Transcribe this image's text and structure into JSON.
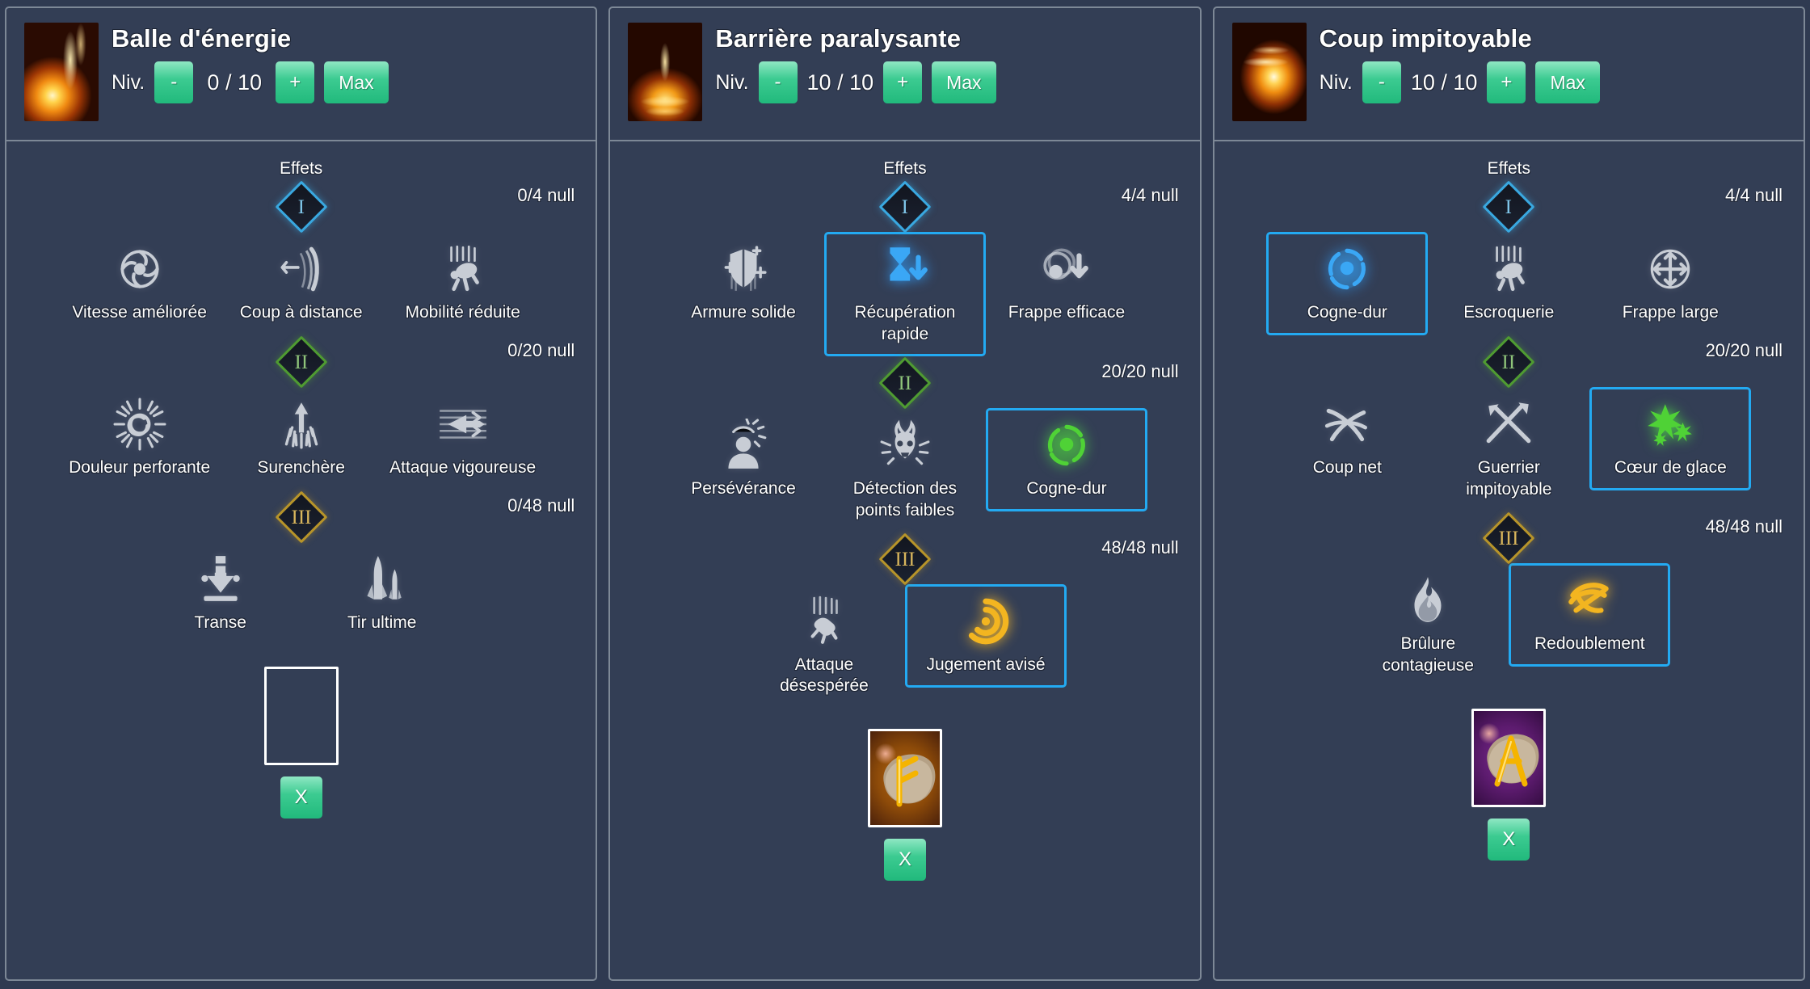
{
  "colors": {
    "page_bg": "#2f3a51",
    "panel_bg": "#333e55",
    "panel_border": "#7d8896",
    "accent_button": "#21b97c",
    "selection_border": "#23aaf2",
    "tier1": "#39a8e0",
    "tier2": "#4f9b31",
    "tier3": "#b79429",
    "text": "#ffffff"
  },
  "common": {
    "level_label": "Niv.",
    "minus_label": "-",
    "plus_label": "+",
    "max_label": "Max",
    "effects_label": "Effets",
    "clear_rune_label": "X"
  },
  "panels": [
    {
      "title": "Balle d'énergie",
      "icon": "comet-icon",
      "level_value": "0 / 10",
      "tiers": [
        {
          "roman": "I",
          "counter": "0/4 null",
          "perks": [
            {
              "name": "Vitesse améliorée",
              "icon": "speed-orb-icon",
              "selected": false,
              "state": "dim"
            },
            {
              "name": "Coup à distance",
              "icon": "ranged-strike-icon",
              "selected": false,
              "state": "dim"
            },
            {
              "name": "Mobilité réduite",
              "icon": "reduced-mobility-icon",
              "selected": false,
              "state": "dim"
            }
          ]
        },
        {
          "roman": "II",
          "counter": "0/20 null",
          "perks": [
            {
              "name": "Douleur perforante",
              "icon": "piercing-pain-icon",
              "selected": false,
              "state": "dim"
            },
            {
              "name": "Surenchère",
              "icon": "overbid-burst-icon",
              "selected": false,
              "state": "dim"
            },
            {
              "name": "Attaque vigoureuse",
              "icon": "vigorous-attack-icon",
              "selected": false,
              "state": "dim"
            }
          ]
        },
        {
          "roman": "III",
          "counter": "0/48 null",
          "perks": [
            {
              "name": "Transe",
              "icon": "trance-arrow-icon",
              "selected": false,
              "state": "dim"
            },
            {
              "name": "Tir ultime",
              "icon": "ultimate-shot-icon",
              "selected": false,
              "state": "dim"
            }
          ]
        }
      ],
      "rune": {
        "present": false,
        "glyph": "",
        "bg": "none"
      }
    },
    {
      "title": "Barrière paralysante",
      "icon": "barrier-icon",
      "level_value": "10 / 10",
      "tiers": [
        {
          "roman": "I",
          "counter": "4/4 null",
          "perks": [
            {
              "name": "Armure solide",
              "icon": "solid-armor-icon",
              "selected": false,
              "state": "dim"
            },
            {
              "name": "Récupération rapide",
              "icon": "fast-recovery-icon",
              "selected": true,
              "state": "lit-blue"
            },
            {
              "name": "Frappe efficace",
              "icon": "efficient-strike-icon",
              "selected": false,
              "state": "dim"
            }
          ]
        },
        {
          "roman": "II",
          "counter": "20/20 null",
          "perks": [
            {
              "name": "Persévérance",
              "icon": "perseverance-icon",
              "selected": false,
              "state": "dim"
            },
            {
              "name": "Détection des points faibles",
              "icon": "weak-point-detection-icon",
              "selected": false,
              "state": "dim"
            },
            {
              "name": "Cogne-dur",
              "icon": "hard-hitter-icon",
              "selected": true,
              "state": "lit-green"
            }
          ]
        },
        {
          "roman": "III",
          "counter": "48/48 null",
          "perks": [
            {
              "name": "Attaque désespérée",
              "icon": "desperate-attack-icon",
              "selected": false,
              "state": "dim"
            },
            {
              "name": "Jugement avisé",
              "icon": "wise-judgment-icon",
              "selected": true,
              "state": "lit-gold"
            }
          ]
        }
      ],
      "rune": {
        "present": true,
        "glyph": "fehu-rune",
        "bg": "brown"
      }
    },
    {
      "title": "Coup impitoyable",
      "icon": "merciless-strike-icon",
      "level_value": "10 / 10",
      "tiers": [
        {
          "roman": "I",
          "counter": "4/4 null",
          "perks": [
            {
              "name": "Cogne-dur",
              "icon": "hard-hitter-icon",
              "selected": true,
              "state": "lit-blue"
            },
            {
              "name": "Escroquerie",
              "icon": "swindle-icon",
              "selected": false,
              "state": "dim"
            },
            {
              "name": "Frappe large",
              "icon": "wide-strike-icon",
              "selected": false,
              "state": "dim"
            }
          ]
        },
        {
          "roman": "II",
          "counter": "20/20 null",
          "perks": [
            {
              "name": "Coup net",
              "icon": "clean-hit-icon",
              "selected": false,
              "state": "dim"
            },
            {
              "name": "Guerrier impitoyable",
              "icon": "merciless-warrior-icon",
              "selected": false,
              "state": "dim"
            },
            {
              "name": "Cœur de glace",
              "icon": "ice-heart-icon",
              "selected": true,
              "state": "lit-green"
            }
          ]
        },
        {
          "roman": "III",
          "counter": "48/48 null",
          "perks": [
            {
              "name": "Brûlure contagieuse",
              "icon": "contagious-burn-icon",
              "selected": false,
              "state": "dim"
            },
            {
              "name": "Redoublement",
              "icon": "redoubling-icon",
              "selected": true,
              "state": "lit-gold"
            }
          ]
        }
      ],
      "rune": {
        "present": true,
        "glyph": "ansuz-rune",
        "bg": "purple"
      }
    }
  ]
}
